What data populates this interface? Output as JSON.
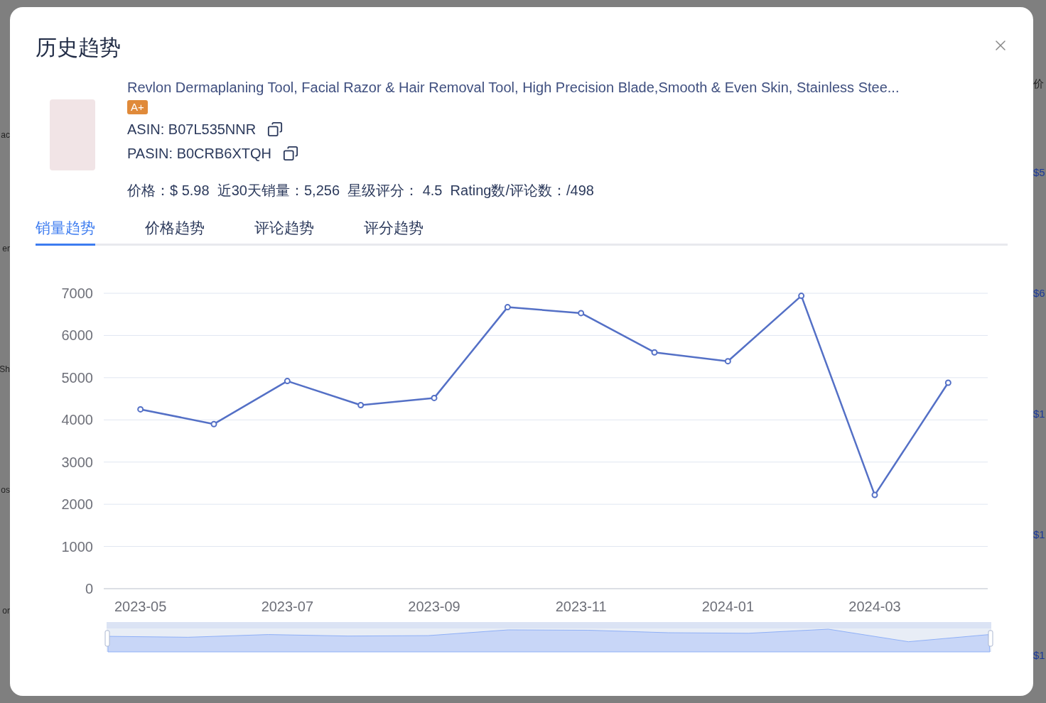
{
  "background": {
    "left_fragments": [
      "ac",
      "er",
      "Sh",
      "os",
      "or"
    ],
    "right_fragments": [
      "价",
      "$5",
      "$6",
      "$1",
      "$1",
      "$1"
    ]
  },
  "dialog": {
    "title": "历史趋势",
    "product": {
      "name": "Revlon Dermaplaning Tool, Facial Razor & Hair Removal Tool, High Precision Blade,Smooth & Even Skin, Stainless Stee...",
      "badge": "A+",
      "asin": "ASIN: B07L535NNR",
      "pasin": "PASIN: B0CRB6XTQH",
      "stats": "价格：$ 5.98  近30天销量：5,256  星级评分： 4.5  Rating数/评论数：/498"
    },
    "tabs": [
      {
        "label": "销量趋势",
        "selected": true
      },
      {
        "label": "价格趋势",
        "selected": false
      },
      {
        "label": "评论趋势",
        "selected": false
      },
      {
        "label": "评分趋势",
        "selected": false
      }
    ],
    "chart_data": {
      "type": "line",
      "categories": [
        "2023-05",
        null,
        "2023-07",
        null,
        "2023-09",
        null,
        "2023-11",
        null,
        "2024-01",
        null,
        "2024-03",
        null
      ],
      "series": [
        {
          "color": "#5470c6",
          "marker": true,
          "values": [
            4250,
            3900,
            4920,
            4350,
            4520,
            6670,
            6530,
            5600,
            5390,
            6940,
            2220,
            4880
          ]
        }
      ],
      "grid": true,
      "ylim": [
        0,
        7000
      ],
      "yticks": [
        0,
        1000,
        2000,
        3000,
        4000,
        5000,
        6000,
        7000
      ]
    }
  }
}
